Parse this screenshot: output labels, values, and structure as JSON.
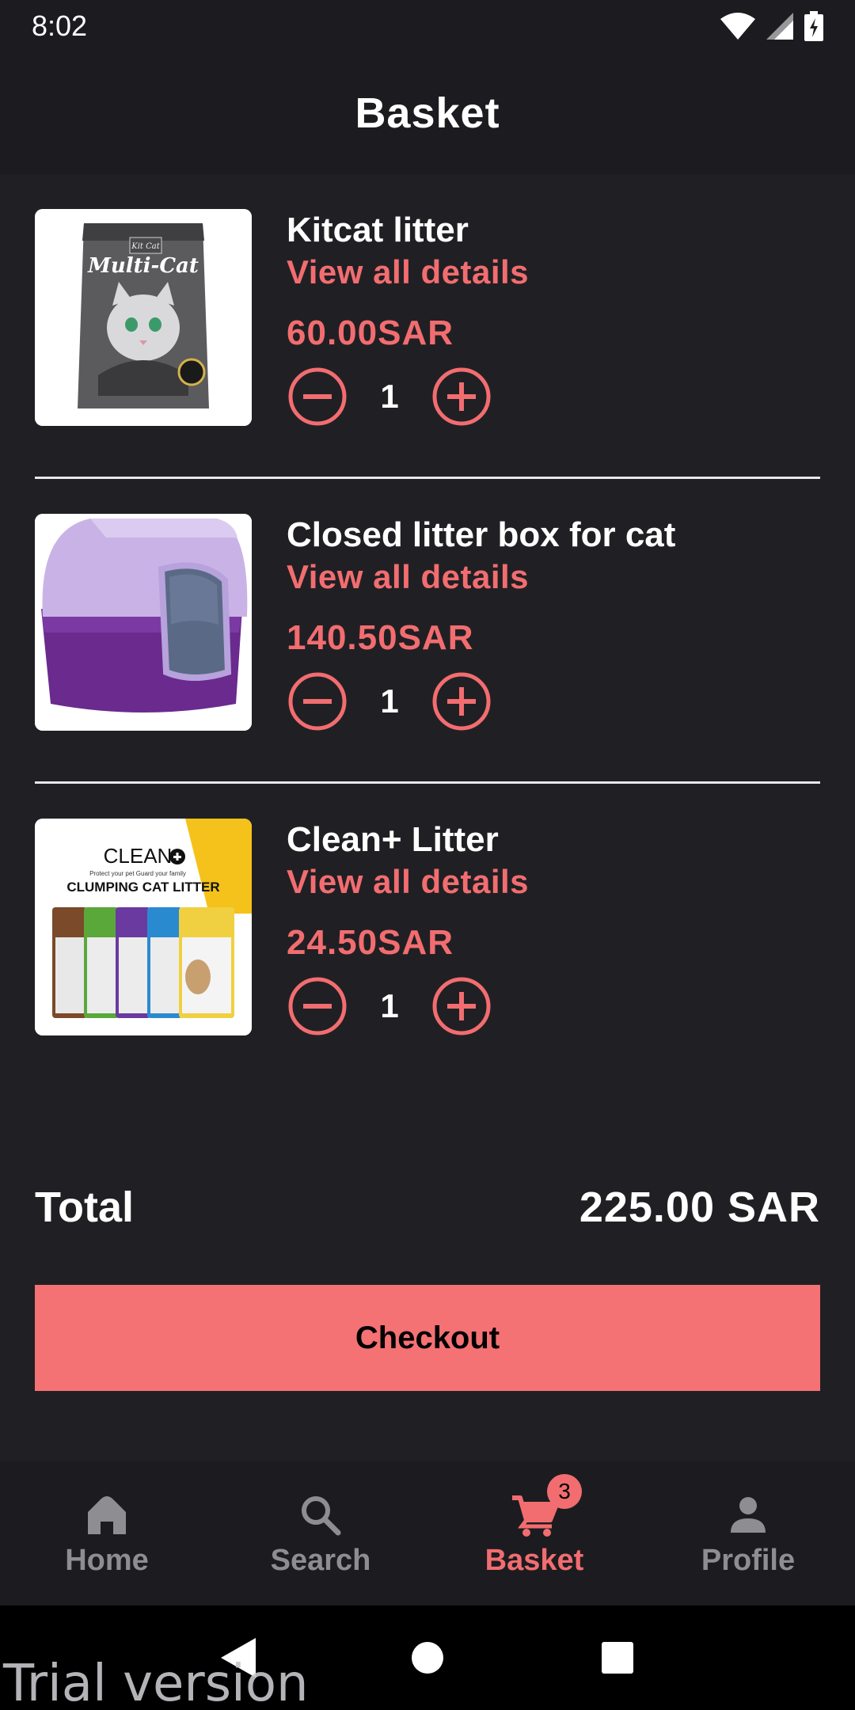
{
  "status_bar": {
    "time": "8:02"
  },
  "header": {
    "title": "Basket"
  },
  "items": [
    {
      "name": "Kitcat litter",
      "details_link": "View all details",
      "price": "60.00SAR",
      "quantity": "1",
      "image_icon": "litter-bag-image",
      "package_brand": "Kit Cat",
      "package_text": "Multi-Cat"
    },
    {
      "name": "Closed litter box for cat",
      "details_link": "View all details",
      "price": "140.50SAR",
      "quantity": "1",
      "image_icon": "litter-box-image"
    },
    {
      "name": "Clean+ Litter",
      "details_link": "View all details",
      "price": "24.50SAR",
      "quantity": "1",
      "image_icon": "litter-bags-image",
      "package_title": "CLEAN",
      "package_slogan": "Protect your pet   Guard your family",
      "package_subtitle": "CLUMPING CAT LITTER"
    }
  ],
  "summary": {
    "total_label": "Total",
    "total_value": "225.00 SAR"
  },
  "checkout": {
    "label": "Checkout"
  },
  "bottom_nav": {
    "items": [
      {
        "label": "Home",
        "icon": "home-icon",
        "active": false
      },
      {
        "label": "Search",
        "icon": "search-icon",
        "active": false
      },
      {
        "label": "Basket",
        "icon": "cart-icon",
        "active": true,
        "badge": "3"
      },
      {
        "label": "Profile",
        "icon": "person-icon",
        "active": false
      }
    ]
  },
  "watermark": "Trial version",
  "colors": {
    "accent": "#f26d70",
    "checkout": "#f47174",
    "background": "#202024",
    "bar": "#1c1c20",
    "inactive": "#8d8d92"
  }
}
